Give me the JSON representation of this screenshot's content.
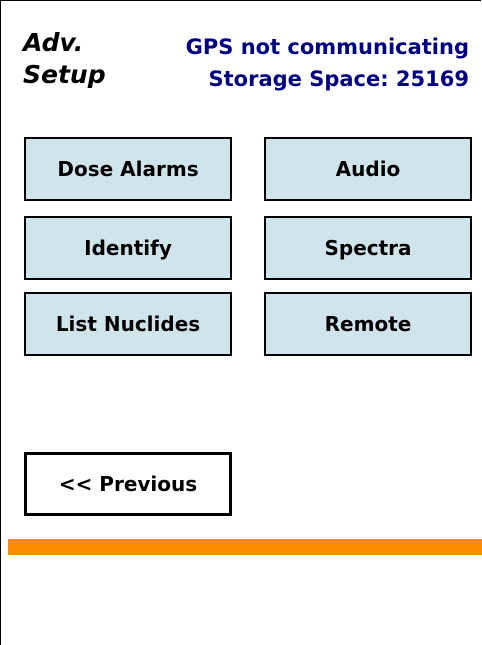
{
  "header": {
    "title_line1": "Adv.",
    "title_line2": "Setup",
    "gps_status": "GPS not communicating",
    "storage_space": "Storage Space: 25169"
  },
  "buttons": {
    "dose_alarms": "Dose Alarms",
    "audio": "Audio",
    "identify": "Identify",
    "spectra": "Spectra",
    "list_nuclides": "List Nuclides",
    "remote": "Remote",
    "previous": "<< Previous"
  },
  "colors": {
    "status_text": "#000080",
    "button_fill": "#d0e4ec",
    "accent_bar": "#ff8c00"
  }
}
